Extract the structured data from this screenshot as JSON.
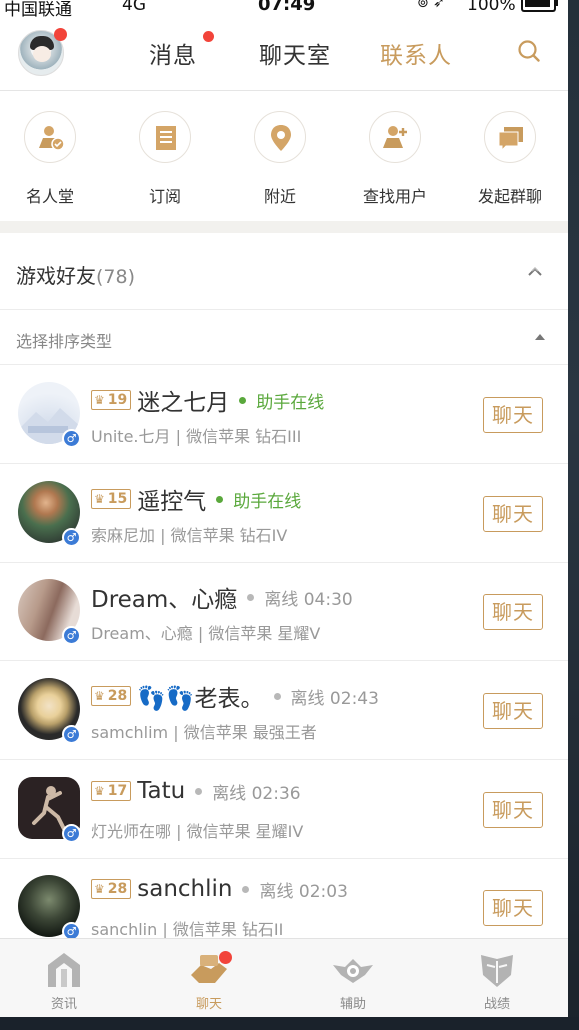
{
  "status_bar": {
    "carrier": "中国联通",
    "network": "4G",
    "time": "07:49",
    "battery": "100%"
  },
  "nav": {
    "tabs": [
      "消息",
      "聊天室",
      "联系人"
    ],
    "active_tab": "联系人"
  },
  "actions": [
    "名人堂",
    "订阅",
    "附近",
    "查找用户",
    "发起群聊"
  ],
  "friends_section": {
    "title": "游戏好友",
    "count": "(78)",
    "sort_label": "选择排序类型"
  },
  "friends": [
    {
      "level": "19",
      "name": "迷之七月",
      "status": "助手在线",
      "online": true,
      "subtitle": "Unite.七月 | 微信苹果 钻石III",
      "chat": "聊天"
    },
    {
      "level": "15",
      "name": "遥控气",
      "status": "助手在线",
      "online": true,
      "subtitle": "索麻尼加 | 微信苹果 钻石IV",
      "chat": "聊天"
    },
    {
      "level": "",
      "name": "Dream、心瘾",
      "status": "离线 04:30",
      "online": false,
      "subtitle": "Dream、心瘾 | 微信苹果 星耀V",
      "chat": "聊天"
    },
    {
      "level": "28",
      "name": "👣👣老表。",
      "status": "离线 02:43",
      "online": false,
      "subtitle": "samchlim | 微信苹果 最强王者",
      "chat": "聊天"
    },
    {
      "level": "17",
      "name": "Tatu",
      "status": "离线 02:36",
      "online": false,
      "subtitle": "灯光师在哪 | 微信苹果 星耀IV",
      "chat": "聊天"
    },
    {
      "level": "28",
      "name": "sanchlin",
      "status": "离线 02:03",
      "online": false,
      "subtitle": "sanchlin | 微信苹果 钻石II",
      "chat": "聊天"
    }
  ],
  "tabbar": {
    "tabs": [
      "资讯",
      "聊天",
      "辅助",
      "战绩"
    ],
    "active": "聊天"
  },
  "colors": {
    "accent": "#c89b5d",
    "online": "#5aa83c",
    "badge_red": "#f2443a",
    "gender_male": "#3c7bd6"
  }
}
